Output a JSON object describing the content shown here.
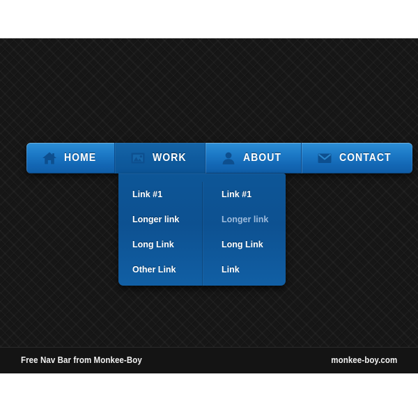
{
  "footer": {
    "left_text": "Free Nav Bar from Monkee-Boy",
    "right_text": "monkee-boy.com"
  },
  "navbar": {
    "items": [
      {
        "label": "Home",
        "icon": "home-icon",
        "state": "default"
      },
      {
        "label": "Work",
        "icon": "picture-icon",
        "state": "active"
      },
      {
        "label": "About",
        "icon": "person-icon",
        "state": "default"
      },
      {
        "label": "Contact",
        "icon": "envelope-icon",
        "state": "default"
      }
    ]
  },
  "dropdown": {
    "parent": "Work",
    "columns": [
      {
        "links": [
          {
            "label": "Link #1",
            "state": "default"
          },
          {
            "label": "Longer link",
            "state": "default"
          },
          {
            "label": "Long Link",
            "state": "default"
          },
          {
            "label": "Other Link",
            "state": "default"
          }
        ]
      },
      {
        "links": [
          {
            "label": "Link #1",
            "state": "default"
          },
          {
            "label": "Longer link",
            "state": "muted"
          },
          {
            "label": "Long Link",
            "state": "default"
          },
          {
            "label": "Link",
            "state": "default"
          }
        ]
      }
    ]
  },
  "colors": {
    "accent_blue": "#1c79c6",
    "active_blue": "#0f5b9e",
    "dropdown_blue": "#0d5191",
    "icon_blue": "#0d4f8f",
    "muted_link": "#9dbbdc",
    "background_dark": "#161616",
    "footer_dark": "#141414",
    "page_white": "#ffffff"
  }
}
